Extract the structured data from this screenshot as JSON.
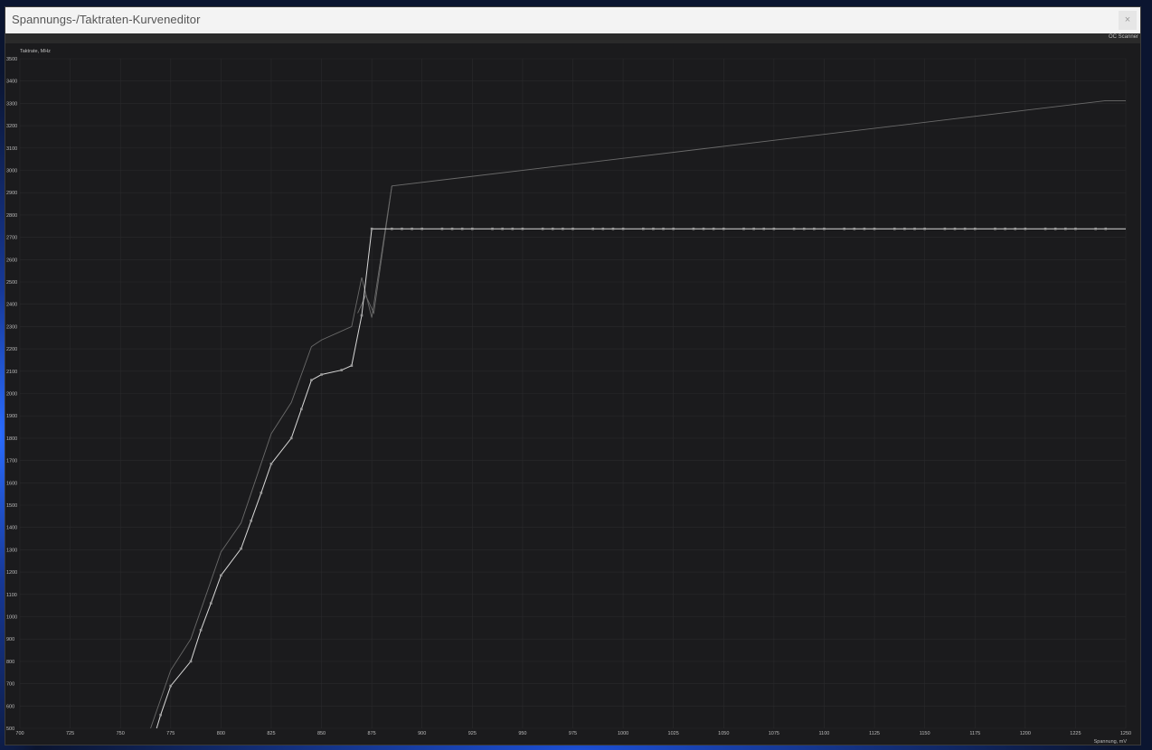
{
  "window": {
    "title": "Spannungs-/Taktraten-Kurveneditor",
    "close_icon": "×"
  },
  "toolbar": {
    "scanner_label": "OC Scanner"
  },
  "colors": {
    "background": "#1b1b1d",
    "grid": "#2a2a2c",
    "curve": "#d8d8d8",
    "ghost": "#6a6a6a",
    "axis_text": "#bdbdbd"
  },
  "chart_data": {
    "type": "line",
    "xlabel": "Spannung, mV",
    "ylabel": "Taktrate, MHz",
    "xlim": [
      700,
      1250
    ],
    "ylim": [
      500,
      3500
    ],
    "x_ticks": [
      700,
      725,
      750,
      775,
      800,
      825,
      850,
      875,
      900,
      925,
      950,
      975,
      1000,
      1025,
      1050,
      1075,
      1100,
      1125,
      1150,
      1175,
      1200,
      1225,
      1250
    ],
    "y_ticks": [
      500,
      600,
      700,
      800,
      900,
      1000,
      1100,
      1200,
      1300,
      1400,
      1500,
      1600,
      1700,
      1800,
      1900,
      2000,
      2100,
      2200,
      2300,
      2400,
      2500,
      2600,
      2700,
      2800,
      2900,
      3000,
      3100,
      3200,
      3300,
      3400,
      3500
    ],
    "grid": true,
    "series": [
      {
        "role": "curve",
        "x": [
          768,
          770,
          775,
          785,
          790,
          795,
          800,
          810,
          815,
          820,
          825,
          835,
          840,
          845,
          850,
          860,
          865,
          870,
          875,
          885,
          890,
          895,
          900,
          910,
          915,
          920,
          925,
          935,
          940,
          945,
          950,
          960,
          965,
          970,
          975,
          985,
          990,
          995,
          1000,
          1010,
          1015,
          1020,
          1025,
          1035,
          1040,
          1045,
          1050,
          1060,
          1065,
          1070,
          1075,
          1085,
          1090,
          1095,
          1100,
          1110,
          1115,
          1120,
          1125,
          1135,
          1140,
          1145,
          1150,
          1160,
          1165,
          1170,
          1175,
          1185,
          1190,
          1195,
          1200,
          1210,
          1215,
          1220,
          1225,
          1235,
          1240,
          1250
        ],
        "y": [
          500,
          560,
          690,
          800,
          940,
          1060,
          1185,
          1305,
          1430,
          1555,
          1685,
          1800,
          1930,
          2060,
          2085,
          2105,
          2125,
          2350,
          2738,
          2738,
          2738,
          2738,
          2738,
          2738,
          2738,
          2738,
          2738,
          2738,
          2738,
          2738,
          2738,
          2738,
          2738,
          2738,
          2738,
          2738,
          2738,
          2738,
          2738,
          2738,
          2738,
          2738,
          2738,
          2738,
          2738,
          2738,
          2738,
          2738,
          2738,
          2738,
          2738,
          2738,
          2738,
          2738,
          2738,
          2738,
          2738,
          2738,
          2738,
          2738,
          2738,
          2738,
          2738,
          2738,
          2738,
          2738,
          2738,
          2738,
          2738,
          2738,
          2738,
          2738,
          2738,
          2738,
          2738,
          2738,
          2738,
          2738
        ]
      },
      {
        "role": "ghost",
        "x": [
          765,
          775,
          785,
          800,
          810,
          825,
          835,
          845,
          850,
          865,
          870,
          875,
          885
        ],
        "y": [
          500,
          760,
          900,
          1290,
          1420,
          1820,
          1960,
          2210,
          2240,
          2300,
          2520,
          2340,
          2930
        ]
      },
      {
        "role": "ghost",
        "x": [
          868,
          872,
          876,
          885,
          1240,
          1250
        ],
        "y": [
          2360,
          2440,
          2360,
          2930,
          3312,
          3312
        ]
      }
    ]
  }
}
